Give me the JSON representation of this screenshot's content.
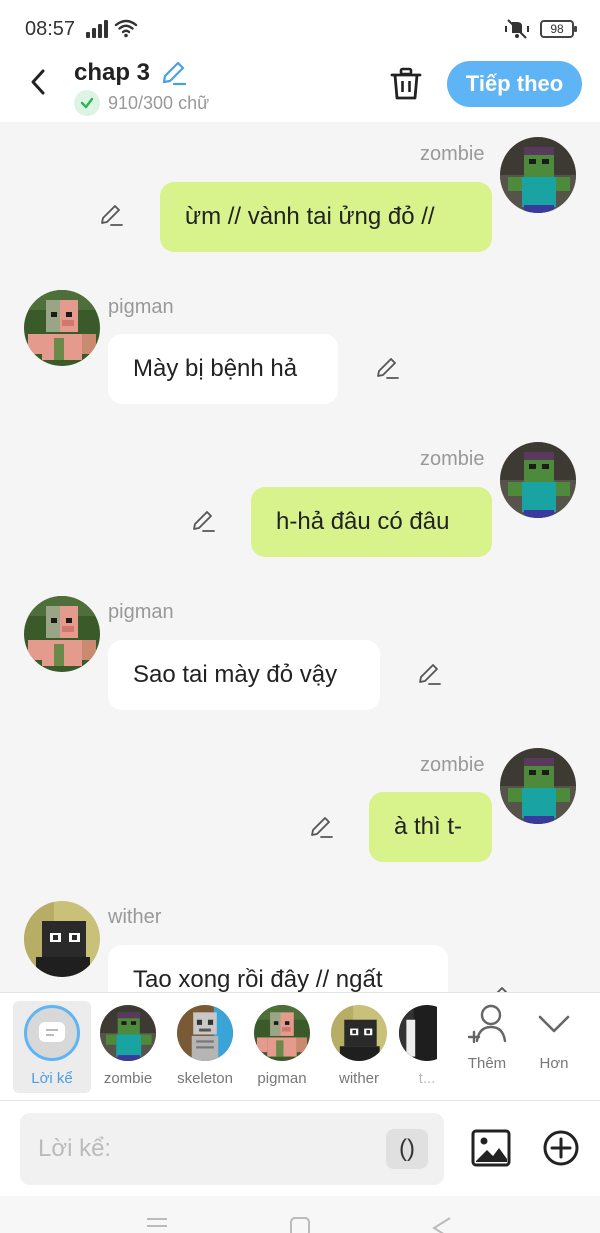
{
  "status_bar": {
    "time": "08:57",
    "battery": "98",
    "icons": [
      "signal-icon",
      "wifi-icon",
      "mute-vibrate-icon",
      "battery-icon"
    ]
  },
  "header": {
    "title": "chap 3",
    "word_count": "910/300 chữ",
    "next_label": "Tiếp theo",
    "icons": [
      "back-arrow-icon",
      "pencil-icon",
      "check-icon",
      "trash-icon"
    ],
    "accent_color": "#5fb4f5"
  },
  "messages": [
    {
      "speaker": "zombie",
      "side": "right",
      "text": "ừm // vành tai ửng đỏ //"
    },
    {
      "speaker": "pigman",
      "side": "left",
      "text": "Mày bị bệnh hả"
    },
    {
      "speaker": "zombie",
      "side": "right",
      "text": "h-hả đâu có đâu"
    },
    {
      "speaker": "pigman",
      "side": "left",
      "text": "Sao tai mày đỏ vậy"
    },
    {
      "speaker": "zombie",
      "side": "right",
      "text": "à thì t-"
    },
    {
      "speaker": "wither",
      "side": "left",
      "text": "Tao xong rồi đây // ngất"
    }
  ],
  "colors": {
    "right_bubble": "#d8f28c",
    "left_bubble": "#ffffff",
    "background": "#f5f5f5"
  },
  "characters": {
    "narrator_label": "Lời kể",
    "items": [
      {
        "label": "zombie"
      },
      {
        "label": "skeleton"
      },
      {
        "label": "pigman"
      },
      {
        "label": "wither"
      },
      {
        "label": "t..."
      }
    ],
    "add_label": "Thêm",
    "more_label": "Hơn"
  },
  "composer": {
    "placeholder": "Lời kể:",
    "paren_label": "()"
  }
}
